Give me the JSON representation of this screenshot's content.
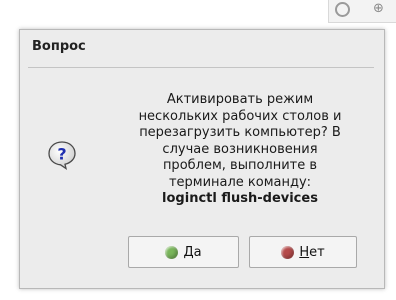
{
  "dialog": {
    "title": "Вопрос",
    "message": "Активировать режим\nнескольких рабочих столов и\nперезагрузить компьютер? В\nслучае возникновения\nпроблем, выполните в\nтерминале команду:",
    "command": "loginctl flush-devices",
    "icon": "question-icon"
  },
  "buttons": {
    "yes": {
      "mnemonic": "Д",
      "rest": "а",
      "icon": "green-dot-icon",
      "color": "#79b55a"
    },
    "no": {
      "mnemonic": "Н",
      "rest": "ет",
      "icon": "red-dot-icon",
      "color": "#b54a4a"
    }
  }
}
